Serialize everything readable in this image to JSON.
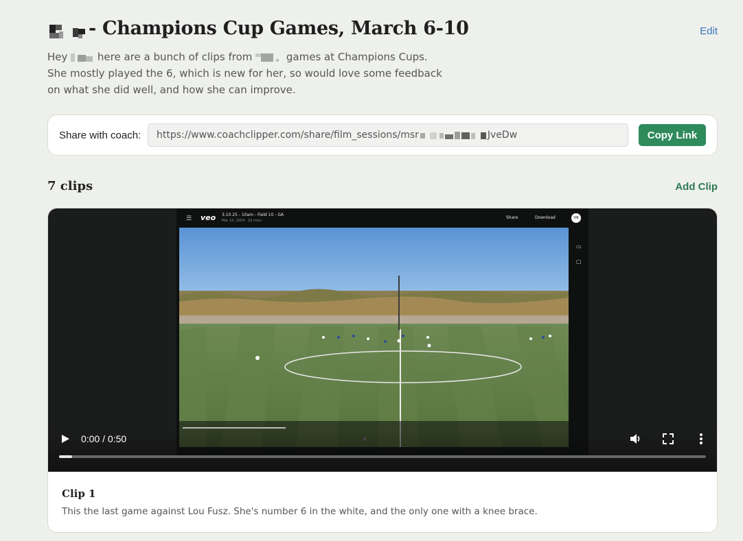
{
  "session": {
    "title": "- Champions Cup Games, March 6-10",
    "edit_label": "Edit",
    "description": {
      "part1": "Hey ",
      "part2": " here are a bunch of clips from ",
      "part3": " games at Champions Cups.",
      "line2": "She mostly played the 6, which is new for her, so would love some feedback",
      "line3": "on what she did well, and how she can improve."
    }
  },
  "share": {
    "label": "Share with coach:",
    "url_start": "https://www.coachclipper.com/share/film_sessions/msr",
    "url_end": "JveDw",
    "copy_label": "Copy Link"
  },
  "clips_header": {
    "count_label": "7 clips",
    "add_label": "Add Clip"
  },
  "clip": {
    "title": "Clip 1",
    "description": "This the last game against Lou Fusz. She's number 6 in the white, and the only one with a knee brace.",
    "time": "0:00 / 0:50",
    "progress": 0.02,
    "embedded_frame": {
      "logo": "veo",
      "game": "3.10.25 - 10am - Field 10 - GA",
      "date": "Mar 10, 2024 · 23 mins",
      "share": "Share",
      "download": "Download",
      "avatar": "DB"
    }
  },
  "icons": {
    "play": "play-icon",
    "volume": "volume-icon",
    "fullscreen": "fullscreen-icon",
    "more": "more-vertical-icon"
  },
  "colors": {
    "background": "#eef0ec",
    "accent": "#2f8a5c",
    "link": "#3a74b8"
  }
}
